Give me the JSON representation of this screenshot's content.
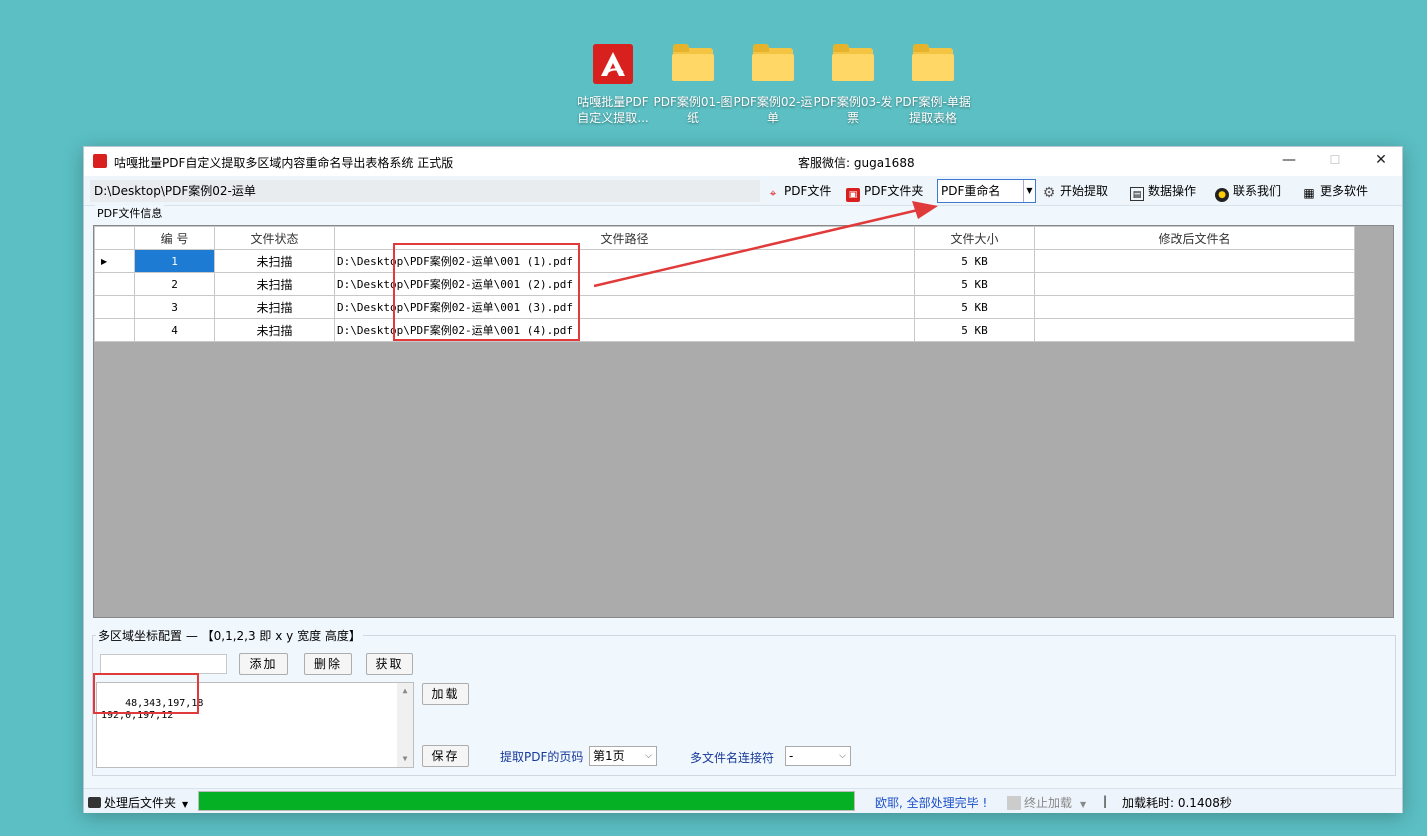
{
  "desktop": {
    "icons": [
      {
        "label": "咕嘎批量PDF自定义提取...",
        "kind": "pdf-app"
      },
      {
        "label": "PDF案例01-图纸",
        "kind": "folder"
      },
      {
        "label": "PDF案例02-运单",
        "kind": "folder"
      },
      {
        "label": "PDF案例03-发票",
        "kind": "folder"
      },
      {
        "label": "PDF案例-单据提取表格",
        "kind": "folder"
      }
    ]
  },
  "window": {
    "title": "咕嘎批量PDF自定义提取多区域内容重命名导出表格系统   正式版",
    "service": "客服微信: guga1688",
    "minimize": "—",
    "maximize": "☐",
    "close": "✕"
  },
  "toolbar": {
    "path": "D:\\Desktop\\PDF案例02-运单",
    "pdf_file": "PDF文件",
    "pdf_folder": "PDF文件夹",
    "mode_select": "PDF重命名",
    "start": "开始提取",
    "data_ops": "数据操作",
    "contact": "联系我们",
    "more": "更多软件"
  },
  "file_info": {
    "group_label": "PDF文件信息",
    "columns": [
      "编 号",
      "文件状态",
      "文件路径",
      "文件大小",
      "修改后文件名"
    ],
    "rows": [
      {
        "no": "1",
        "status": "未扫描",
        "path": "D:\\Desktop\\PDF案例02-运单\\001 (1).pdf",
        "size": "5 KB",
        "newname": ""
      },
      {
        "no": "2",
        "status": "未扫描",
        "path": "D:\\Desktop\\PDF案例02-运单\\001 (2).pdf",
        "size": "5 KB",
        "newname": ""
      },
      {
        "no": "3",
        "status": "未扫描",
        "path": "D:\\Desktop\\PDF案例02-运单\\001 (3).pdf",
        "size": "5 KB",
        "newname": ""
      },
      {
        "no": "4",
        "status": "未扫描",
        "path": "D:\\Desktop\\PDF案例02-运单\\001 (4).pdf",
        "size": "5 KB",
        "newname": ""
      }
    ]
  },
  "config": {
    "group_label": "多区域坐标配置 — 【0,1,2,3 即 x y 宽度 高度】",
    "add": "添加",
    "delete": "删除",
    "fetch": "获取",
    "load": "加载",
    "save": "保存",
    "coords_text": "48,343,197,18\n192,0,197,12",
    "page_label": "提取PDF的页码",
    "page_value": "第1页",
    "joiner_label": "多文件名连接符",
    "joiner_value": "-"
  },
  "status": {
    "folder_button": "处理后文件夹",
    "progress_percent": 100,
    "message": "欧耶, 全部处理完毕 !",
    "stop_load": "终止加载",
    "separator": "|",
    "load_time": "加载耗时: 0.1408秒"
  },
  "colors": {
    "desktop_bg": "#5bbfc3",
    "progress_fill": "#06b025",
    "annotation_red": "#e03a3a",
    "selected_cell": "#1e7bd4"
  }
}
